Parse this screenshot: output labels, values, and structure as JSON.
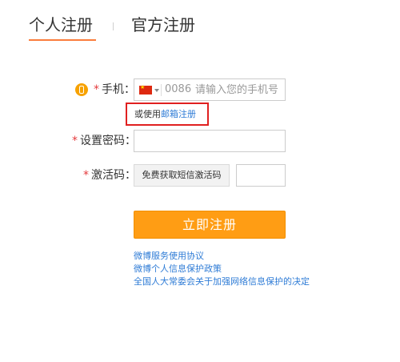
{
  "tabs": {
    "personal": "个人注册",
    "official": "官方注册"
  },
  "form": {
    "phone_label": "手机：",
    "country_code": "0086",
    "phone_placeholder": "请输入您的手机号",
    "alt_prefix": "或使用",
    "alt_link": "邮箱注册",
    "password_label": "设置密码：",
    "password_value": "",
    "activation_label": "激活码：",
    "sms_button": "免费获取短信激活码",
    "activation_value": "",
    "required_mark": "*",
    "submit": "立即注册"
  },
  "links": [
    "微博服务使用协议",
    "微博个人信息保护政策",
    "全国人大常委会关于加强网络信息保护的决定"
  ],
  "colors": {
    "accent": "#fa7d3c",
    "submit": "#ff9d14",
    "link": "#2f7cd6",
    "required": "#e4393c",
    "highlight_box": "#e02020"
  },
  "icons": {
    "phone": "phone-icon",
    "flag": "china-flag-icon"
  }
}
